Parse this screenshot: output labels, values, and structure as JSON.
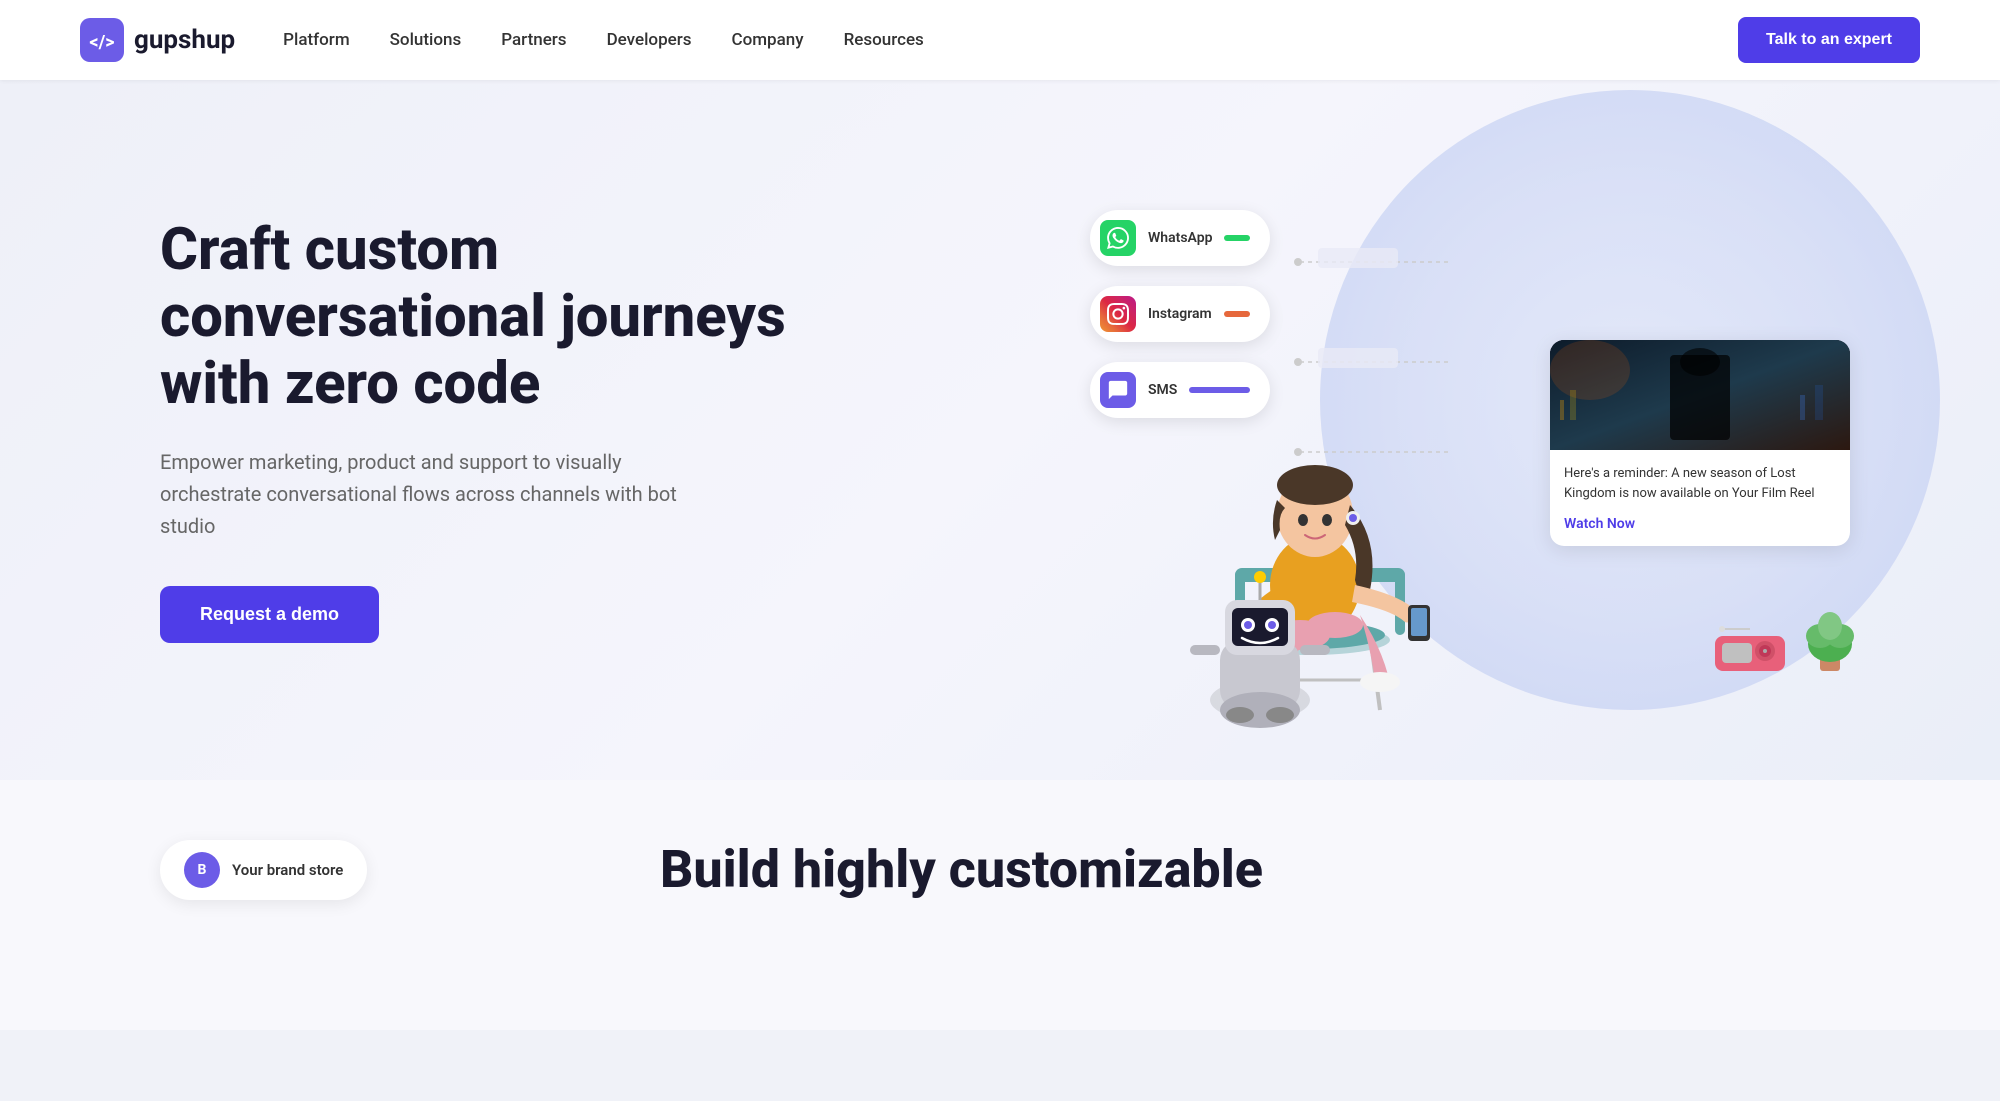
{
  "brand": {
    "logo_text": "gupshup",
    "logo_icon_color": "#5b4de8"
  },
  "navbar": {
    "links": [
      {
        "id": "platform",
        "label": "Platform"
      },
      {
        "id": "solutions",
        "label": "Solutions"
      },
      {
        "id": "partners",
        "label": "Partners"
      },
      {
        "id": "developers",
        "label": "Developers"
      },
      {
        "id": "company",
        "label": "Company"
      },
      {
        "id": "resources",
        "label": "Resources"
      }
    ],
    "cta_label": "Talk to an expert"
  },
  "hero": {
    "title": "Craft custom conversational journeys with zero code",
    "subtitle": "Empower marketing, product and support to visually orchestrate conversational flows across channels with bot studio",
    "cta_label": "Request a demo"
  },
  "channels": [
    {
      "id": "whatsapp",
      "label": "WhatsApp",
      "color": "#25d366"
    },
    {
      "id": "instagram",
      "label": "Instagram",
      "color": "#e6683c"
    },
    {
      "id": "sms",
      "label": "SMS",
      "color": "#6c5ce7"
    }
  ],
  "film_card": {
    "reminder_text": "Here's a reminder: A new season of Lost Kingdom is now available on Your Film Reel",
    "watch_now_label": "Watch Now"
  },
  "bottom": {
    "brand_store_badge": "Your brand store",
    "badge_letter": "B",
    "title_line1": "Build highly customizable"
  }
}
